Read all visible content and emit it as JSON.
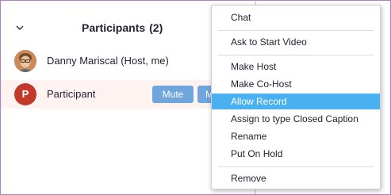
{
  "header": {
    "title": "Participants",
    "count": "(2)",
    "collapse_icon": "chevron-down-icon"
  },
  "participants": [
    {
      "name": "Danny Mariscal (Host, me)",
      "avatar": "photo"
    },
    {
      "name": "Participant",
      "avatar_letter": "P",
      "mute_label": "Mute",
      "more_label": "M"
    }
  ],
  "colors": {
    "accent": "#4ab1f0",
    "button": "#6fa6dc",
    "avatar_red": "#c0392b",
    "frame": "#b47cc7"
  },
  "menu": {
    "items": [
      {
        "label": "Chat"
      },
      {
        "label": "Ask to Start Video"
      },
      {
        "label": "Make Host"
      },
      {
        "label": "Make Co-Host"
      },
      {
        "label": "Allow Record",
        "selected": true
      },
      {
        "label": "Assign to type Closed Caption"
      },
      {
        "label": "Rename"
      },
      {
        "label": "Put On Hold"
      },
      {
        "label": "Remove"
      }
    ]
  }
}
